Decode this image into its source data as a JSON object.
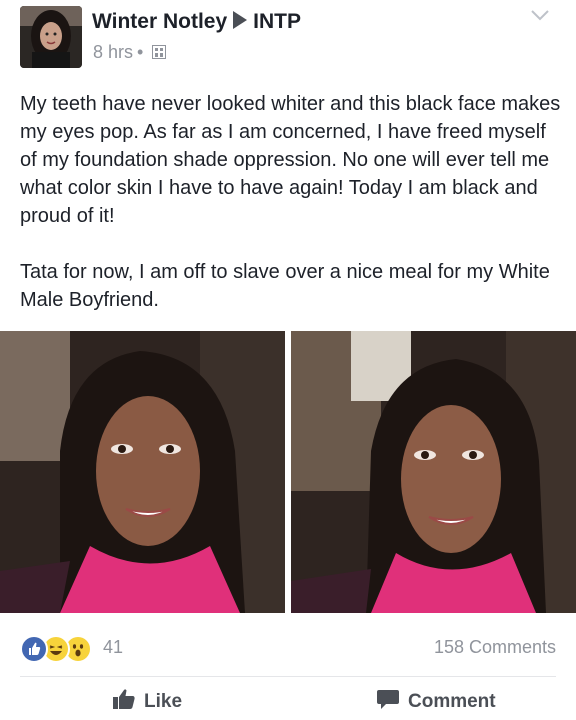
{
  "post": {
    "author": "Winter Notley",
    "target": "INTP",
    "time": "8 hrs",
    "privacy_icon": "friends-icon",
    "text_p1": "My teeth have never looked whiter and this black face makes my eyes pop. As far as I am concerned, I have freed myself of my foundation shade oppression. No one will ever tell me what color skin I have to have again! Today I am black and proud of it!",
    "text_p2": "Tata for now, I am off to slave over a nice meal for my White Male  Boyfriend."
  },
  "reactions": {
    "types": [
      "like-icon",
      "haha-icon",
      "wow-icon"
    ],
    "count": "41",
    "comments": "158 Comments"
  },
  "actions": {
    "like_label": "Like",
    "comment_label": "Comment"
  },
  "colors": {
    "like_blue": "#4267b2",
    "reaction_yellow": "#f7d33b",
    "meta_gray": "#90949c",
    "scarf_pink": "#e0307a"
  }
}
